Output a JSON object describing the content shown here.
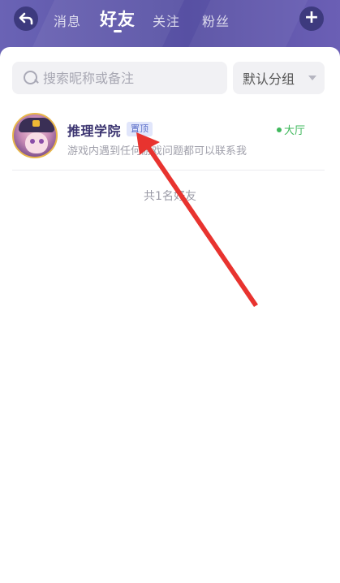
{
  "header": {
    "tabs": [
      {
        "label": "消息",
        "active": false
      },
      {
        "label": "好友",
        "active": true
      },
      {
        "label": "关注",
        "active": false
      },
      {
        "label": "粉丝",
        "active": false
      }
    ],
    "back_icon": "back-arrow-icon",
    "add_icon": "plus-icon"
  },
  "search": {
    "placeholder": "搜索昵称或备注",
    "value": ""
  },
  "group_select": {
    "selected": "默认分组"
  },
  "friends": [
    {
      "name": "推理学院",
      "badge": "置顶",
      "message": "游戏内遇到任何游戏问题都可以联系我",
      "status": "大厅",
      "status_color": "#3fb85c"
    }
  ],
  "total_text": "共1名好友",
  "colors": {
    "header_bg": "#5b55a6",
    "accent": "#3b3470",
    "annotation_arrow": "#e8332f"
  }
}
